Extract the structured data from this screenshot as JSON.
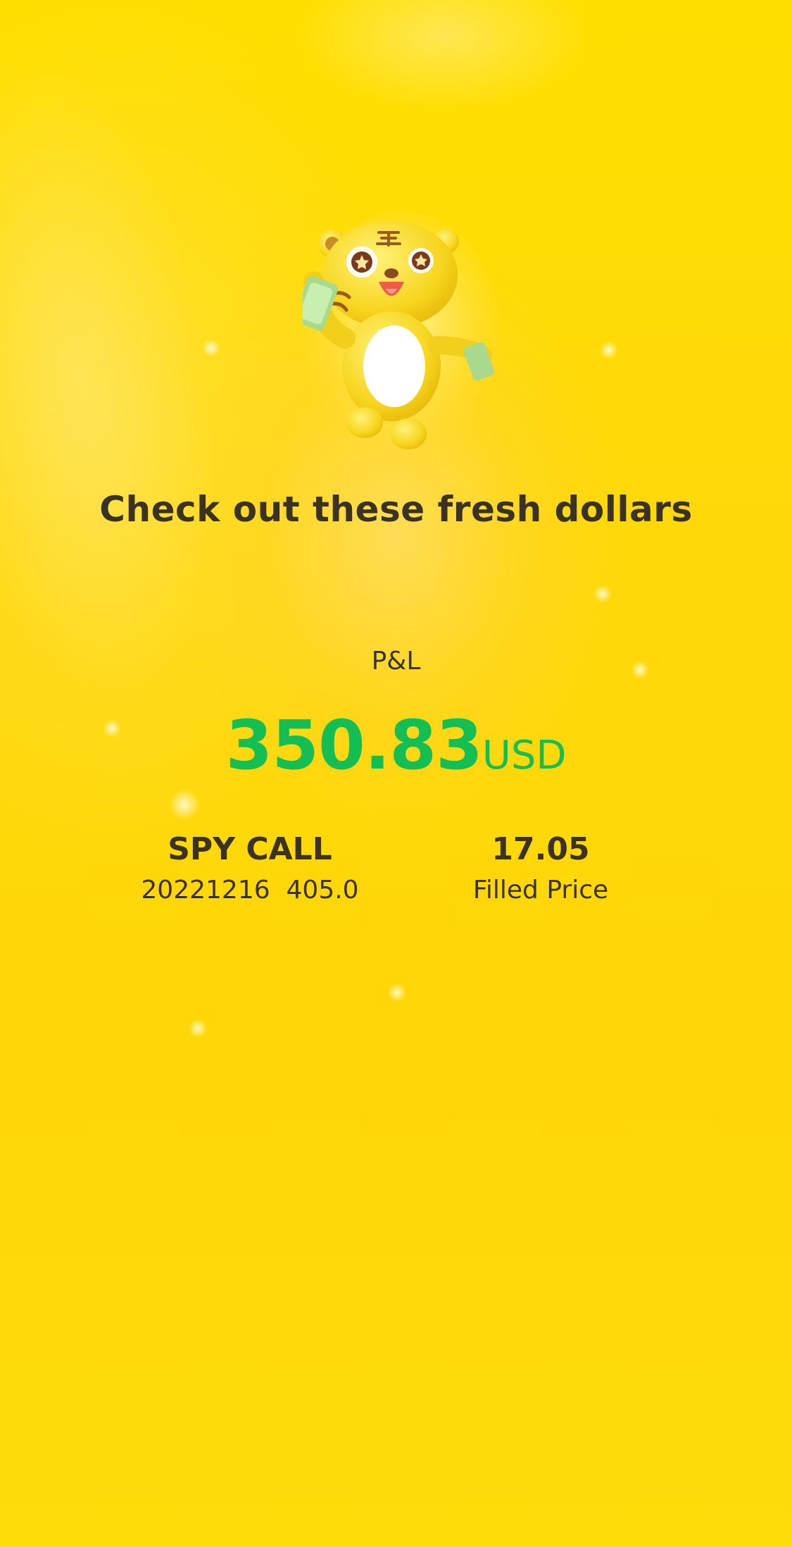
{
  "headline": "Check out these fresh dollars",
  "pnl": {
    "label": "P&L",
    "value": "350.83",
    "unit": "USD",
    "color": "#13BE55"
  },
  "position": {
    "symbol": "SPY CALL",
    "contract": "20221216  405.0"
  },
  "fill": {
    "price": "17.05",
    "label": "Filled Price"
  },
  "colors": {
    "background": "#FFD709",
    "text": "#3a3222"
  },
  "mascot": {
    "icon": "tiger-mascot-holding-cash-icon"
  }
}
